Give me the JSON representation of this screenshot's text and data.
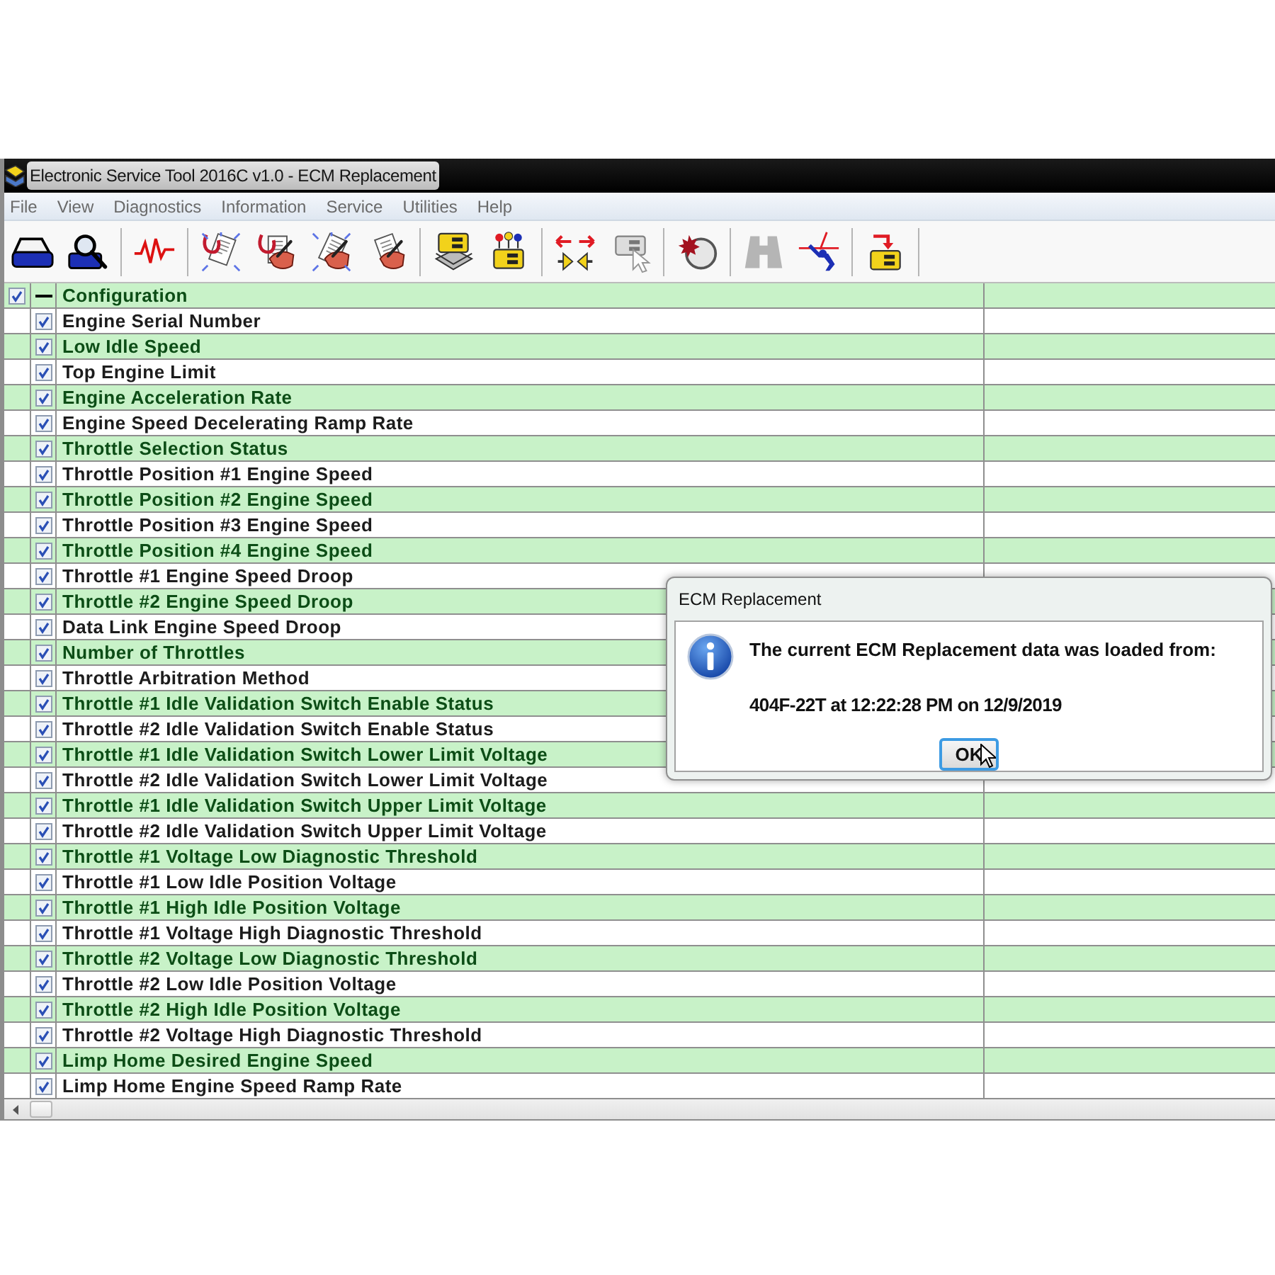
{
  "window": {
    "title": "Electronic Service Tool 2016C v1.0 - ECM Replacement"
  },
  "menu": [
    "File",
    "View",
    "Diagnostics",
    "Information",
    "Service",
    "Utilities",
    "Help"
  ],
  "toolbar": {
    "groups": [
      [
        {
          "disabled": false
        },
        {
          "disabled": false
        }
      ],
      [
        {
          "disabled": false
        }
      ],
      [
        {
          "disabled": false
        },
        {
          "disabled": false
        },
        {
          "disabled": false
        },
        {
          "disabled": false
        }
      ],
      [
        {
          "disabled": false
        },
        {
          "disabled": false
        }
      ],
      [
        {
          "disabled": false
        },
        {
          "disabled": true
        }
      ],
      [
        {
          "disabled": false
        }
      ],
      [
        {
          "disabled": true
        },
        {
          "disabled": false
        }
      ],
      [
        {
          "disabled": false
        }
      ]
    ]
  },
  "table": {
    "groups": [
      {
        "label": "Configuration",
        "checked": true,
        "expanded": true,
        "children": [
          {
            "label": "Engine Serial Number",
            "checked": true
          },
          {
            "label": "Low Idle Speed",
            "checked": true
          },
          {
            "label": "Top Engine Limit",
            "checked": true
          },
          {
            "label": "Engine Acceleration Rate",
            "checked": true
          },
          {
            "label": "Engine Speed Decelerating Ramp Rate",
            "checked": true
          },
          {
            "label": "Throttle Selection Status",
            "checked": true
          },
          {
            "label": "Throttle Position #1 Engine Speed",
            "checked": true
          },
          {
            "label": "Throttle Position #2 Engine Speed",
            "checked": true
          },
          {
            "label": "Throttle Position #3 Engine Speed",
            "checked": true
          },
          {
            "label": "Throttle Position #4 Engine Speed",
            "checked": true
          },
          {
            "label": "Throttle #1 Engine Speed Droop",
            "checked": true
          },
          {
            "label": "Throttle #2 Engine Speed Droop",
            "checked": true
          },
          {
            "label": "Data Link Engine Speed Droop",
            "checked": true
          },
          {
            "label": "Number of Throttles",
            "checked": true
          },
          {
            "label": "Throttle Arbitration Method",
            "checked": true
          },
          {
            "label": "Throttle #1 Idle Validation Switch Enable Status",
            "checked": true
          },
          {
            "label": "Throttle #2 Idle Validation Switch Enable Status",
            "checked": true
          },
          {
            "label": "Throttle #1 Idle Validation Switch Lower Limit Voltage",
            "checked": true
          },
          {
            "label": "Throttle #2 Idle Validation Switch Lower Limit Voltage",
            "checked": true
          },
          {
            "label": "Throttle #1 Idle Validation Switch Upper Limit Voltage",
            "checked": true
          },
          {
            "label": "Throttle #2 Idle Validation Switch Upper Limit Voltage",
            "checked": true
          },
          {
            "label": "Throttle #1 Voltage Low Diagnostic Threshold",
            "checked": true
          },
          {
            "label": "Throttle #1 Low Idle Position Voltage",
            "checked": true
          },
          {
            "label": "Throttle #1 High Idle Position Voltage",
            "checked": true
          },
          {
            "label": "Throttle #1 Voltage High Diagnostic Threshold",
            "checked": true
          },
          {
            "label": "Throttle #2 Voltage Low Diagnostic Threshold",
            "checked": true
          },
          {
            "label": "Throttle #2 Low Idle Position Voltage",
            "checked": true
          },
          {
            "label": "Throttle #2 High Idle Position Voltage",
            "checked": true
          },
          {
            "label": "Throttle #2 Voltage High Diagnostic Threshold",
            "checked": true
          },
          {
            "label": "Limp Home Desired Engine Speed",
            "checked": true
          },
          {
            "label": "Limp Home Engine Speed Ramp Rate",
            "checked": true
          }
        ]
      }
    ]
  },
  "dialog": {
    "title": "ECM Replacement",
    "message": "The current ECM Replacement data was loaded from:",
    "detail": "404F-22T at 12:22:28 PM on 12/9/2019",
    "buttons": [
      {
        "label": "OK",
        "focused": true
      }
    ]
  }
}
